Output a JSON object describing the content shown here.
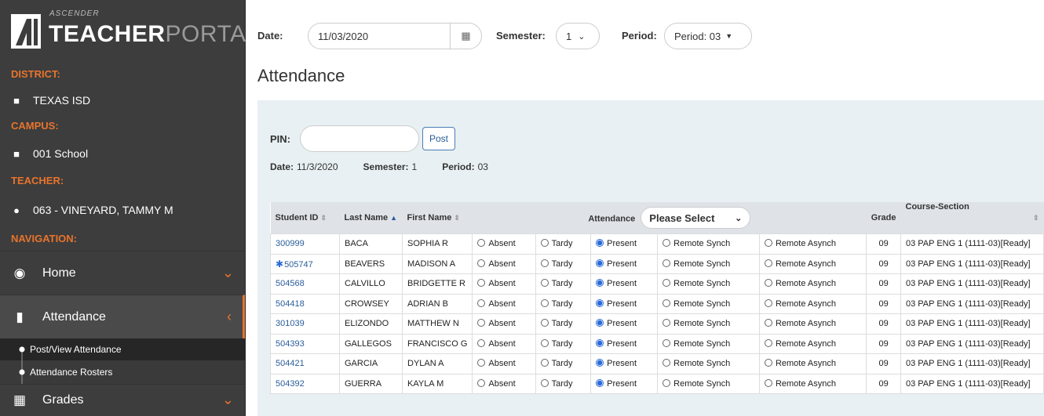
{
  "app": {
    "logo_ascender": "ASCENDER",
    "logo_teacher": "TEACHER",
    "logo_portal": "PORTAL"
  },
  "sidebar": {
    "district_label": "DISTRICT:",
    "district_value": "TEXAS ISD",
    "campus_label": "CAMPUS:",
    "campus_value": "001 School",
    "teacher_label": "TEACHER:",
    "teacher_value": "063 - VINEYARD, TAMMY M",
    "navigation_label": "NAVIGATION:",
    "nav": {
      "home": "Home",
      "attendance": "Attendance",
      "post_view": "Post/View Attendance",
      "rosters": "Attendance Rosters",
      "grades": "Grades"
    },
    "accent": "#e8742c"
  },
  "toolbar": {
    "date_label": "Date:",
    "date_value": "11/03/2020",
    "semester_label": "Semester:",
    "semester_value": "1",
    "period_label": "Period:",
    "period_value": "Period: 03"
  },
  "page_title": "Attendance",
  "pin": {
    "label": "PIN:",
    "value": "",
    "post_label": "Post"
  },
  "info": {
    "date_key": "Date:",
    "date_val": "11/3/2020",
    "semester_key": "Semester:",
    "semester_val": "1",
    "period_key": "Period:",
    "period_val": "03"
  },
  "table": {
    "headers": {
      "student_id": "Student ID",
      "last_name": "Last Name",
      "first_name": "First Name",
      "attendance": "Attendance",
      "attendance_select": "Please Select",
      "grade": "Grade",
      "course_section": "Course-Section"
    },
    "options": [
      "Absent",
      "Tardy",
      "Present",
      "Remote Synch",
      "Remote Asynch"
    ],
    "rows": [
      {
        "id": "300999",
        "last": "BACA",
        "first": "SOPHIA R",
        "selected": "Present",
        "grade": "09",
        "course": "03 PAP ENG 1 (1111-03)[Ready]",
        "flag": false
      },
      {
        "id": "505747",
        "last": "BEAVERS",
        "first": "MADISON A",
        "selected": "Present",
        "grade": "09",
        "course": "03 PAP ENG 1 (1111-03)[Ready]",
        "flag": true
      },
      {
        "id": "504568",
        "last": "CALVILLO",
        "first": "BRIDGETTE R",
        "selected": "Present",
        "grade": "09",
        "course": "03 PAP ENG 1 (1111-03)[Ready]",
        "flag": false
      },
      {
        "id": "504418",
        "last": "CROWSEY",
        "first": "ADRIAN B",
        "selected": "Present",
        "grade": "09",
        "course": "03 PAP ENG 1 (1111-03)[Ready]",
        "flag": false
      },
      {
        "id": "301039",
        "last": "ELIZONDO",
        "first": "MATTHEW N",
        "selected": "Present",
        "grade": "09",
        "course": "03 PAP ENG 1 (1111-03)[Ready]",
        "flag": false
      },
      {
        "id": "504393",
        "last": "GALLEGOS",
        "first": "FRANCISCO G",
        "selected": "Present",
        "grade": "09",
        "course": "03 PAP ENG 1 (1111-03)[Ready]",
        "flag": false
      },
      {
        "id": "504421",
        "last": "GARCIA",
        "first": "DYLAN A",
        "selected": "Present",
        "grade": "09",
        "course": "03 PAP ENG 1 (1111-03)[Ready]",
        "flag": false
      },
      {
        "id": "504392",
        "last": "GUERRA",
        "first": "KAYLA M",
        "selected": "Present",
        "grade": "09",
        "course": "03 PAP ENG 1 (1111-03)[Ready]",
        "flag": false
      }
    ]
  }
}
